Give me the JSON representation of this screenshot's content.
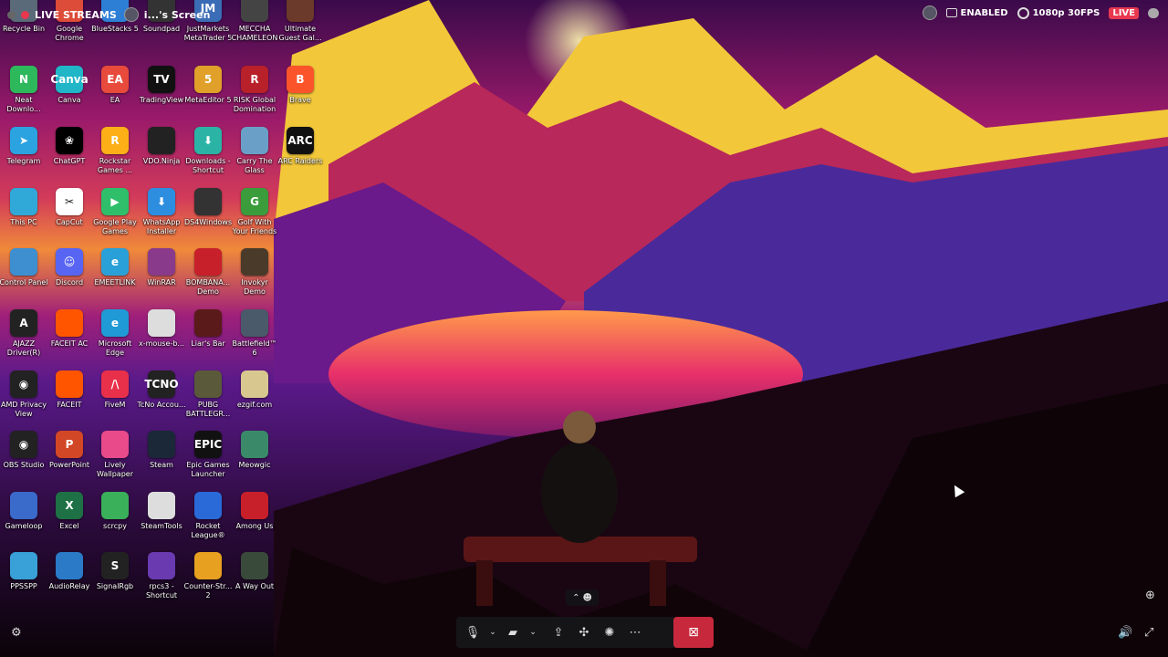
{
  "stream": {
    "title": "LIVE STREAMS",
    "screen_label": "i...'s Screen",
    "enabled_label": "ENABLED",
    "quality": "1080p 30FPS",
    "live_label": "LIVE"
  },
  "desktop_icons": [
    {
      "label": "Recycle Bin",
      "color": "#5a6a78",
      "glyph": ""
    },
    {
      "label": "Google Chrome",
      "color": "#dd4b39",
      "glyph": ""
    },
    {
      "label": "BlueStacks 5",
      "color": "#2d7fd6",
      "glyph": ""
    },
    {
      "label": "Soundpad",
      "color": "#333333",
      "glyph": ""
    },
    {
      "label": "JustMarkets MetaTrader 5",
      "color": "#3b6cb6",
      "glyph": "JM"
    },
    {
      "label": "MECCHA CHAMELEON",
      "color": "#444444",
      "glyph": ""
    },
    {
      "label": "Ultimate Guest Gal...",
      "color": "#6b3a2a",
      "glyph": ""
    },
    {
      "label": "Neat Downlo...",
      "color": "#2eb85c",
      "glyph": "N"
    },
    {
      "label": "Canva",
      "color": "#20b6c8",
      "glyph": "Canva"
    },
    {
      "label": "EA",
      "color": "#e84a3c",
      "glyph": "EA"
    },
    {
      "label": "TradingView",
      "color": "#111111",
      "glyph": "TV"
    },
    {
      "label": "MetaEditor 5",
      "color": "#e0a02a",
      "glyph": "5"
    },
    {
      "label": "RISK Global Domination",
      "color": "#b8202a",
      "glyph": "R"
    },
    {
      "label": "Brave",
      "color": "#fb542b",
      "glyph": "B"
    },
    {
      "label": "Telegram",
      "color": "#2aa3e0",
      "glyph": "➤"
    },
    {
      "label": "ChatGPT",
      "color": "#000000",
      "glyph": "❀"
    },
    {
      "label": "Rockstar Games ...",
      "color": "#fcaf17",
      "glyph": "R"
    },
    {
      "label": "VDO.Ninja",
      "color": "#222222",
      "glyph": ""
    },
    {
      "label": "Downloads - Shortcut",
      "color": "#2bb4a6",
      "glyph": "⬇"
    },
    {
      "label": "Carry The Glass",
      "color": "#6aa0c8",
      "glyph": ""
    },
    {
      "label": "ARC Raiders",
      "color": "#111111",
      "glyph": "ARC"
    },
    {
      "label": "This PC",
      "color": "#30a8d8",
      "glyph": ""
    },
    {
      "label": "CapCut",
      "color": "#ffffff",
      "glyph": "✂"
    },
    {
      "label": "Google Play Games",
      "color": "#2fbf6a",
      "glyph": "▶"
    },
    {
      "label": "WhatsApp Installer",
      "color": "#2d8ee0",
      "glyph": "⬇"
    },
    {
      "label": "DS4Windows",
      "color": "#333333",
      "glyph": ""
    },
    {
      "label": "Golf With Your Friends",
      "color": "#3b9c3b",
      "glyph": "G"
    },
    {
      "label": "Control Panel",
      "color": "#3d8fd0",
      "glyph": ""
    },
    {
      "label": "Discord",
      "color": "#5865f2",
      "glyph": "☺"
    },
    {
      "label": "EMEETLINK",
      "color": "#2aa0d8",
      "glyph": "e"
    },
    {
      "label": "WinRAR",
      "color": "#8a3a8a",
      "glyph": ""
    },
    {
      "label": "BOMBANA... Demo",
      "color": "#c8202a",
      "glyph": ""
    },
    {
      "label": "Invokyr Demo",
      "color": "#4a3a2a",
      "glyph": ""
    },
    {
      "label": "AJAZZ Driver(R)",
      "color": "#222222",
      "glyph": "A"
    },
    {
      "label": "FACEIT AC",
      "color": "#ff5500",
      "glyph": ""
    },
    {
      "label": "Microsoft Edge",
      "color": "#1f9ad6",
      "glyph": "e"
    },
    {
      "label": "x-mouse-b...",
      "color": "#dddddd",
      "glyph": ""
    },
    {
      "label": "Liar's Bar",
      "color": "#5a1a1a",
      "glyph": ""
    },
    {
      "label": "Battlefield™ 6",
      "color": "#4a5a6a",
      "glyph": ""
    },
    {
      "label": "AMD Privacy View",
      "color": "#222222",
      "glyph": "◉"
    },
    {
      "label": "FACEIT",
      "color": "#ff5500",
      "glyph": ""
    },
    {
      "label": "FiveM",
      "color": "#e8304a",
      "glyph": "/\\"
    },
    {
      "label": "TcNo Accou...",
      "color": "#222222",
      "glyph": "TCNO"
    },
    {
      "label": "PUBG BATTLEGR...",
      "color": "#5a5a3a",
      "glyph": ""
    },
    {
      "label": "ezgif.com",
      "color": "#d8c890",
      "glyph": ""
    },
    {
      "label": "OBS Studio",
      "color": "#222222",
      "glyph": "◉"
    },
    {
      "label": "PowerPoint",
      "color": "#d24726",
      "glyph": "P"
    },
    {
      "label": "Lively Wallpaper",
      "color": "#e84a8a",
      "glyph": ""
    },
    {
      "label": "Steam",
      "color": "#1b2838",
      "glyph": ""
    },
    {
      "label": "Epic Games Launcher",
      "color": "#111111",
      "glyph": "EPIC"
    },
    {
      "label": "Meowgic",
      "color": "#3a8a6a",
      "glyph": ""
    },
    {
      "label": "Gameloop",
      "color": "#3a6aca",
      "glyph": ""
    },
    {
      "label": "Excel",
      "color": "#1e7145",
      "glyph": "X"
    },
    {
      "label": "scrcpy",
      "color": "#3ab05a",
      "glyph": ""
    },
    {
      "label": "SteamTools",
      "color": "#dddddd",
      "glyph": ""
    },
    {
      "label": "Rocket League®",
      "color": "#2a6ad8",
      "glyph": ""
    },
    {
      "label": "Among Us",
      "color": "#c8202a",
      "glyph": ""
    },
    {
      "label": "PPSSPP",
      "color": "#3aa0d8",
      "glyph": ""
    },
    {
      "label": "AudioRelay",
      "color": "#2a7ac8",
      "glyph": ""
    },
    {
      "label": "SignalRgb",
      "color": "#222222",
      "glyph": "S"
    },
    {
      "label": "rpcs3 - Shortcut",
      "color": "#6a3ab0",
      "glyph": ""
    },
    {
      "label": "Counter-Str... 2",
      "color": "#e8a020",
      "glyph": ""
    },
    {
      "label": "A Way Out",
      "color": "#3a4a3a",
      "glyph": ""
    }
  ],
  "toolbar": {
    "mic_icon": "microphone-icon",
    "camera_icon": "camera-off-icon",
    "share_icon": "screen-share-icon",
    "activities_icon": "activities-icon",
    "soundboard_icon": "soundboard-icon",
    "more_icon": "more-icon",
    "leave_icon": "leave-call-icon"
  }
}
